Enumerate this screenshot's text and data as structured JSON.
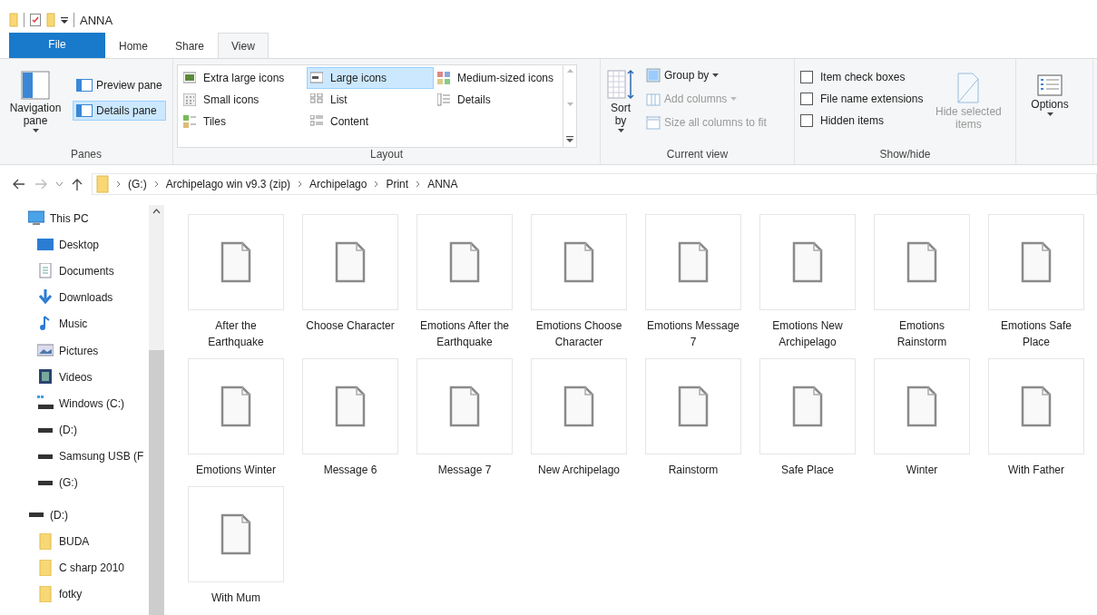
{
  "title_bar": {
    "title": "ANNA"
  },
  "tabs": [
    {
      "label": "File",
      "kind": "file",
      "selected": false
    },
    {
      "label": "Home",
      "kind": "normal",
      "selected": false
    },
    {
      "label": "Share",
      "kind": "normal",
      "selected": false
    },
    {
      "label": "View",
      "kind": "normal",
      "selected": true
    }
  ],
  "ribbon": {
    "panes": {
      "label": "Panes",
      "navigation_pane": "Navigation pane",
      "items": [
        {
          "label": "Preview pane",
          "selected": false
        },
        {
          "label": "Details pane",
          "selected": true
        }
      ]
    },
    "layout": {
      "label": "Layout",
      "items": [
        {
          "label": "Extra large icons",
          "kind": "xl",
          "selected": false
        },
        {
          "label": "Large icons",
          "kind": "large",
          "selected": true
        },
        {
          "label": "Medium-sized icons",
          "kind": "medium",
          "selected": false
        },
        {
          "label": "Small icons",
          "kind": "small",
          "selected": false
        },
        {
          "label": "List",
          "kind": "list",
          "selected": false
        },
        {
          "label": "Details",
          "kind": "details",
          "selected": false
        },
        {
          "label": "Tiles",
          "kind": "tiles",
          "selected": false
        },
        {
          "label": "Content",
          "kind": "content",
          "selected": false
        }
      ]
    },
    "current_view": {
      "label": "Current view",
      "sort_by": "Sort by",
      "items": [
        {
          "label": "Group by",
          "kind": "group",
          "disabled": false
        },
        {
          "label": "Add columns",
          "kind": "columns",
          "disabled": true
        },
        {
          "label": "Size all columns to fit",
          "kind": "size",
          "disabled": true
        }
      ]
    },
    "show_hide": {
      "label": "Show/hide",
      "checkboxes": [
        {
          "label": "Item check boxes",
          "checked": false
        },
        {
          "label": "File name extensions",
          "checked": false
        },
        {
          "label": "Hidden items",
          "checked": false
        }
      ],
      "hide_selected": {
        "label": "Hide selected items",
        "disabled": true
      }
    },
    "options": {
      "label": "Options"
    }
  },
  "address_bar": {
    "segments": [
      "(G:)",
      "Archipelago win v9.3 (zip)",
      "Archipelago",
      "Print",
      "ANNA"
    ]
  },
  "navigation": [
    {
      "label": "This PC",
      "kind": "pc",
      "children": [
        {
          "label": "Desktop",
          "kind": "desktop"
        },
        {
          "label": "Documents",
          "kind": "documents"
        },
        {
          "label": "Downloads",
          "kind": "downloads"
        },
        {
          "label": "Music",
          "kind": "music"
        },
        {
          "label": "Pictures",
          "kind": "pictures"
        },
        {
          "label": "Videos",
          "kind": "videos"
        },
        {
          "label": "Windows (C:)",
          "kind": "system-drive"
        },
        {
          "label": "(D:)",
          "kind": "drive"
        },
        {
          "label": "Samsung USB (F",
          "kind": "drive"
        },
        {
          "label": "(G:)",
          "kind": "drive"
        }
      ]
    },
    {
      "label": "(D:)",
      "kind": "drive",
      "children": [
        {
          "label": "BUDA",
          "kind": "folder"
        },
        {
          "label": "C sharp 2010",
          "kind": "folder"
        },
        {
          "label": "fotky",
          "kind": "folder"
        }
      ]
    }
  ],
  "files": [
    "After the Earthquake",
    "Choose Character",
    "Emotions After the Earthquake",
    "Emotions Choose Character",
    "Emotions Message 7",
    "Emotions New Archipelago",
    "Emotions Rainstorm",
    "Emotions Safe Place",
    "Emotions Winter",
    "Message 6",
    "Message 7",
    "New Archipelago",
    "Rainstorm",
    "Safe Place",
    "Winter",
    "With Father",
    "With Mum"
  ]
}
